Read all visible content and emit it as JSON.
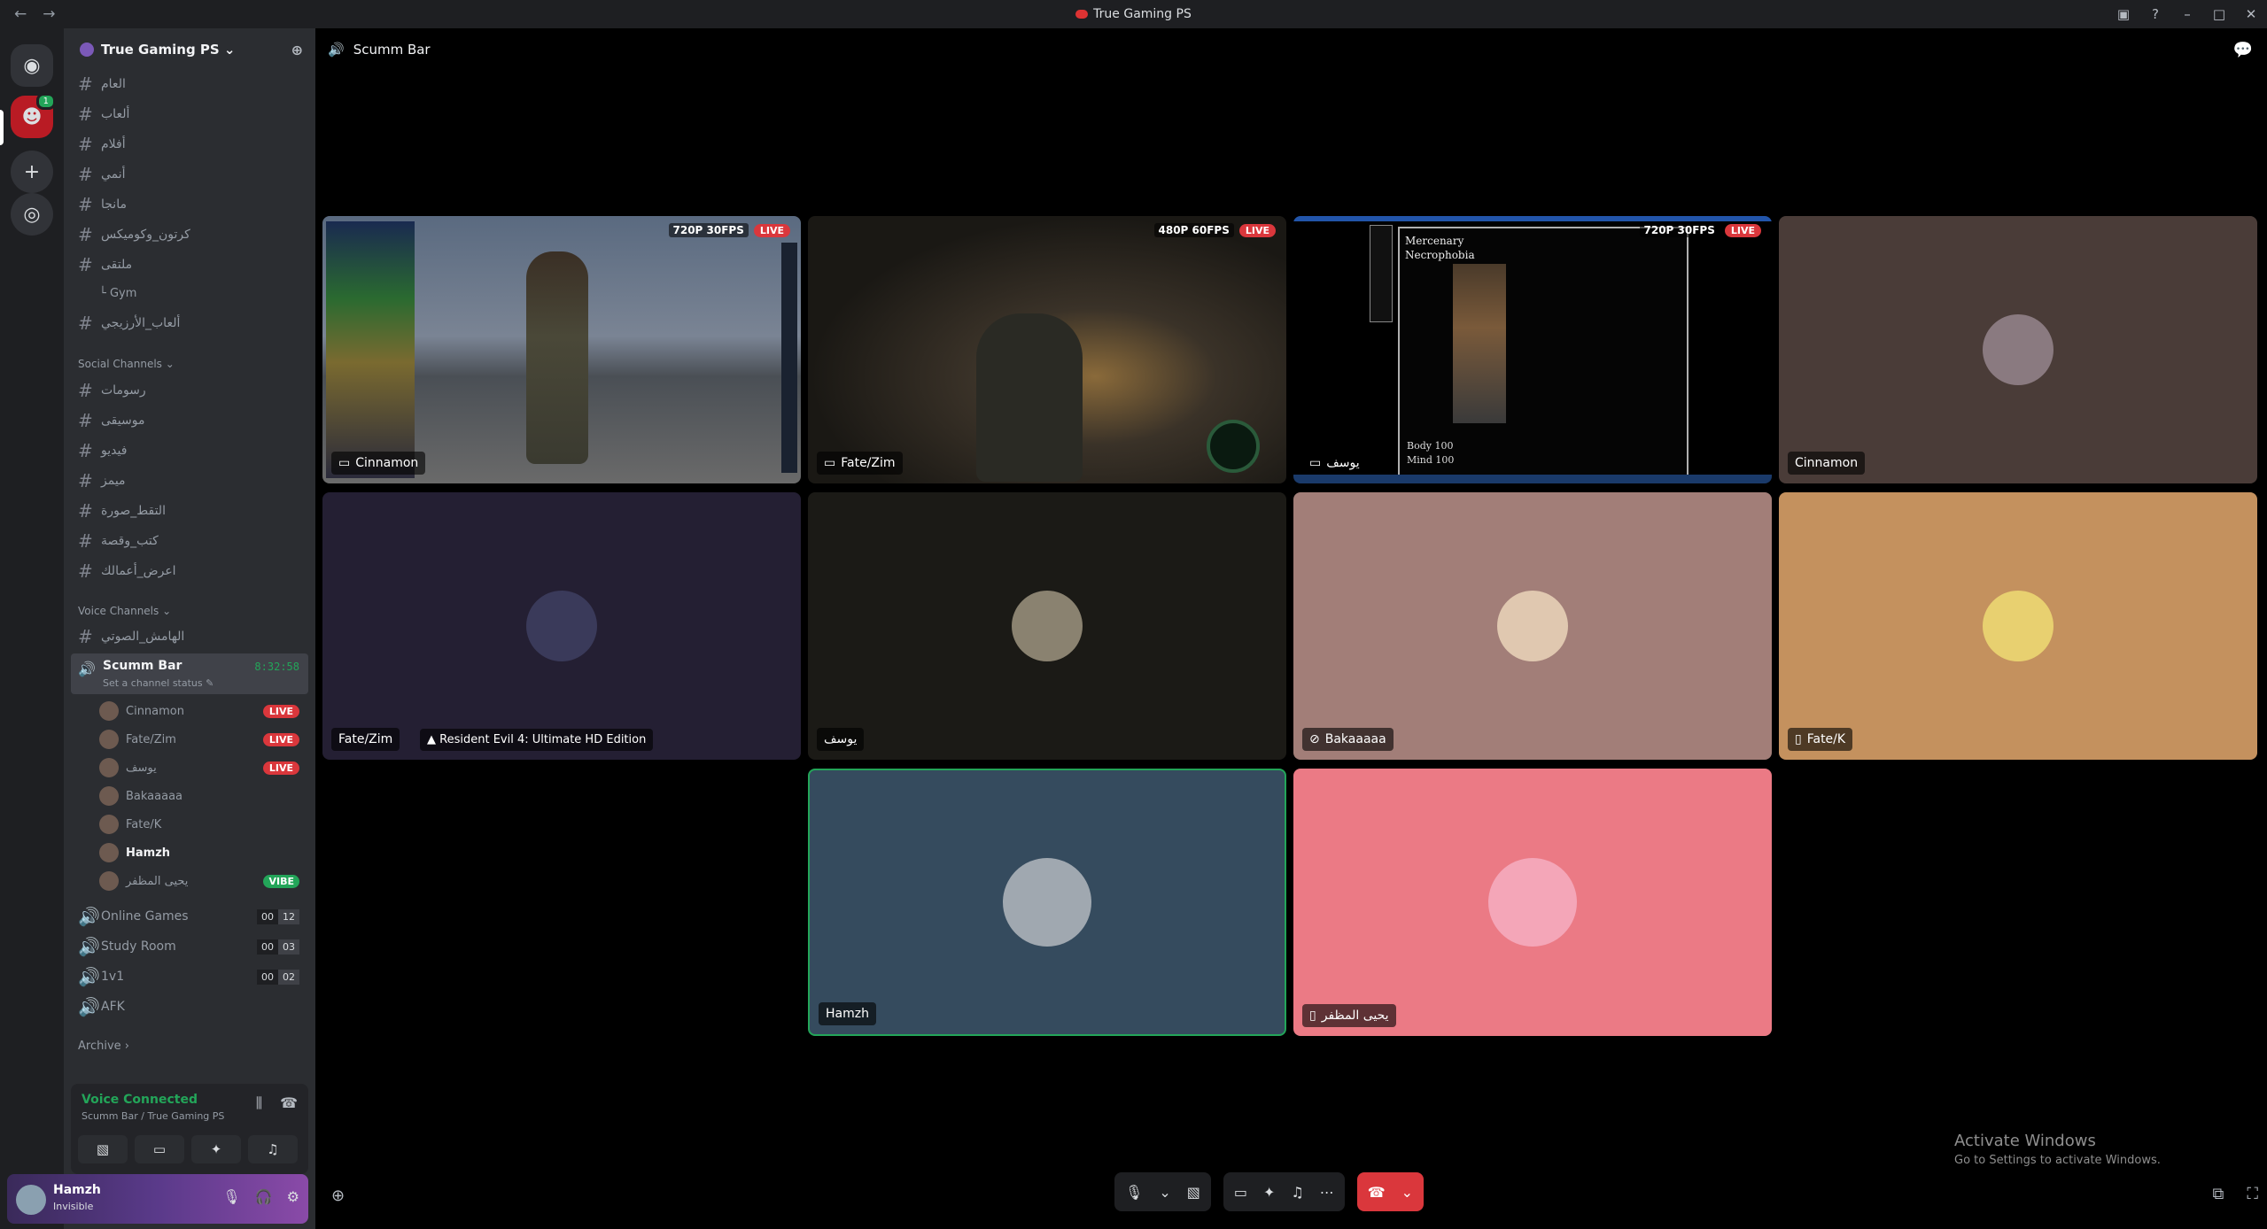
{
  "window": {
    "title": "True Gaming PS",
    "back": "←",
    "forward": "→"
  },
  "server": {
    "name": "True Gaming PS ⌄"
  },
  "channels": [
    {
      "name": "العام"
    },
    {
      "name": "ألعاب"
    },
    {
      "name": "أفلام"
    },
    {
      "name": "أنمي"
    },
    {
      "name": "مانجا"
    },
    {
      "name": "كرتون_وكوميكس"
    },
    {
      "name": "ملتقى"
    },
    {
      "name": "ألعاب_الأرزيجي"
    }
  ],
  "gym": "Gym",
  "social": {
    "label": "Social Channels ⌄",
    "channels": [
      {
        "name": "رسومات"
      },
      {
        "name": "موسيقى"
      },
      {
        "name": "فيديو"
      },
      {
        "name": "ميمز"
      },
      {
        "name": "التقط_صورة"
      },
      {
        "name": "كتب_وقصة"
      },
      {
        "name": "اعرض_أعمالك"
      }
    ]
  },
  "voice": {
    "label": "Voice Channels ⌄",
    "hamish": "الهامش_الصوتي",
    "active": {
      "name": "Scumm Bar",
      "status": "Set a channel status ✎",
      "timer": "8:32:58"
    },
    "members": [
      {
        "name": "Cinnamon",
        "tag": "LIVE"
      },
      {
        "name": "Fate/Zim",
        "tag": "LIVE"
      },
      {
        "name": "يوسف",
        "tag": "LIVE"
      },
      {
        "name": "Bakaaaaa",
        "tag": ""
      },
      {
        "name": "Fate/K",
        "tag": ""
      },
      {
        "name": "Hamzh",
        "tag": ""
      },
      {
        "name": "يحيى المظفر",
        "tag": "VIBE"
      }
    ],
    "others": [
      {
        "name": "Online Games",
        "a": "00",
        "b": "12"
      },
      {
        "name": "Study Room",
        "a": "00",
        "b": "03"
      },
      {
        "name": "1v1",
        "a": "00",
        "b": "02"
      },
      {
        "name": "AFK"
      }
    ]
  },
  "archive": "Archive ›",
  "voicebar": {
    "status": "Voice Connected",
    "location": "Scumm Bar / True Gaming PS"
  },
  "user": {
    "name": "Hamzh",
    "status": "Invisible"
  },
  "main": {
    "channel": "Scumm Bar"
  },
  "tiles": [
    {
      "label": "Cinnamon",
      "res": "720P 30FPS",
      "live": "LIVE"
    },
    {
      "label": "Fate/Zim",
      "res": "480P 60FPS",
      "live": "LIVE"
    },
    {
      "label": "يوسف",
      "res": "720P 30FPS",
      "live": "LIVE",
      "merc": "Mercenary",
      "necro": "Necrophobia",
      "body": "Body",
      "mind": "Mind",
      "v1": "100",
      "v2": "100"
    },
    {
      "label": "Cinnamon"
    },
    {
      "label": "Fate/Zim",
      "activity": "Resident Evil 4: Ultimate HD Edition"
    },
    {
      "label": "يوسف"
    },
    {
      "label": "Bakaaaaa"
    },
    {
      "label": "Fate/K"
    },
    {
      "label": "Hamzh"
    },
    {
      "label": "يحيى المظفر"
    }
  ],
  "windows_activation": {
    "title": "Activate Windows",
    "sub": "Go to Settings to activate Windows."
  },
  "colors": {
    "live": "#da373c",
    "speaking": "#23a559",
    "accent": "#5865f2"
  }
}
